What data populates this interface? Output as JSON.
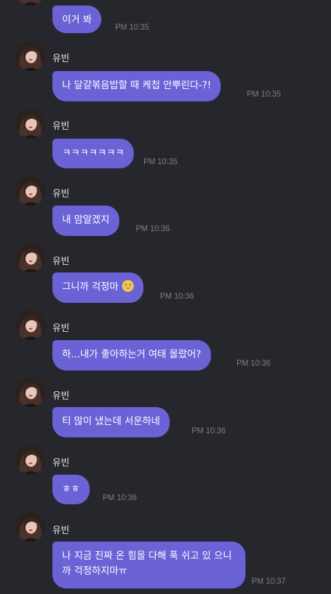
{
  "messages": [
    {
      "sender": "",
      "text": "이거 봐",
      "time": "PM 10:35"
    },
    {
      "sender": "유빈",
      "text": "나 달걀볶음밥할 때 케첩 안뿌린다-?!",
      "time": "PM 10:35"
    },
    {
      "sender": "유빈",
      "text": "ㅋㅋㅋㅋㅋㅋㅋ",
      "time": "PM 10:35"
    },
    {
      "sender": "유빈",
      "text": "내 맘알겠지",
      "time": "PM 10:36"
    },
    {
      "sender": "유빈",
      "text": "그니까 걱정마",
      "emoji": "grinning-face-icon",
      "time": "PM 10:36"
    },
    {
      "sender": "유빈",
      "text": "하...내가 좋아하는거 여태 몰랐어?",
      "time": "PM 10:36"
    },
    {
      "sender": "유빈",
      "text": "티 많이 냈는데 서운하네",
      "time": "PM 10:36"
    },
    {
      "sender": "유빈",
      "text": "ㅎㅎ",
      "time": "PM 10:36"
    },
    {
      "sender": "유빈",
      "text": "나 지금 진짜 온 힘을 다해 푹 쉬고 있 으니까 걱정하지마ㅠ",
      "time": "PM 10:37"
    }
  ],
  "colors": {
    "background": "#26262d",
    "bubble": "#6b62d6",
    "timestamp": "#7f7f8a"
  }
}
